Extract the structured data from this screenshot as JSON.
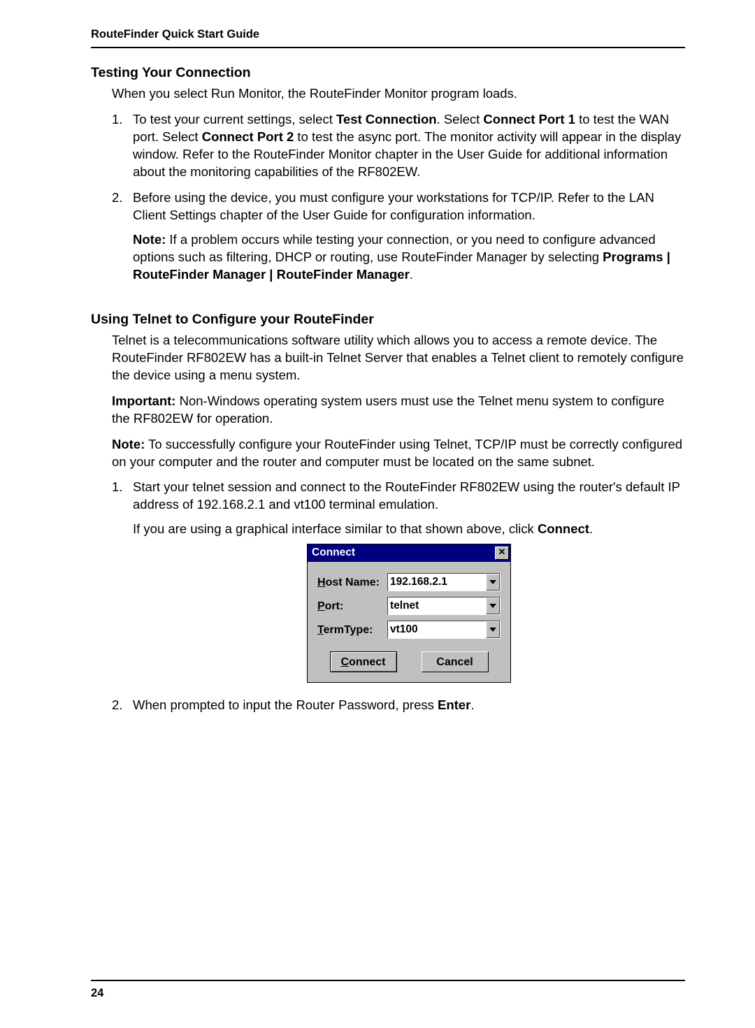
{
  "header": {
    "title": "RouteFinder Quick Start Guide"
  },
  "section1": {
    "heading": "Testing Your Connection",
    "intro": "When you select Run Monitor, the RouteFinder Monitor program loads.",
    "items": {
      "n1": "1.",
      "p1a": "To test your current settings, select ",
      "p1b": "Test Connection",
      "p1c": ".  Select ",
      "p1d": "Connect Port 1",
      "p1e": " to test the WAN port.  Select ",
      "p1f": "Connect Port 2",
      "p1g": " to test the async port.  The monitor activity will appear in the display window.  Refer to the RouteFinder Monitor chapter in the User Guide for additional information about the monitoring capabilities of the RF802EW.",
      "n2": "2.",
      "p2": "Before using the device, you must configure your workstations for TCP/IP.  Refer to the LAN Client Settings chapter of the User Guide for configuration information.",
      "p2note_a": "Note:",
      "p2note_b": " If a problem occurs while testing your connection, or you need to configure advanced options such as filtering, DHCP or routing, use RouteFinder Manager by selecting ",
      "p2note_c": "Programs | RouteFinder Manager | RouteFinder Manager",
      "p2note_d": "."
    }
  },
  "section2": {
    "heading": "Using Telnet to Configure your RouteFinder",
    "p1": "Telnet is a telecommunications software utility which allows you to access a remote device. The RouteFinder RF802EW has a built-in Telnet Server that enables a Telnet client to remotely configure the device using a menu system.",
    "p2a": "Important:",
    "p2b": " Non-Windows operating system users must use the Telnet menu system to configure the RF802EW for operation.",
    "p3a": "Note:",
    "p3b": " To successfully configure your RouteFinder using Telnet, TCP/IP must be correctly configured on your computer and the router and computer must be located on the same subnet.",
    "items": {
      "n1": "1.",
      "p1": "Start your telnet session and connect to the RouteFinder RF802EW using the router's default IP address of 192.168.2.1 and vt100 terminal emulation.",
      "p1b_a": "If you are using a graphical interface similar to that shown above, click ",
      "p1b_b": "Connect",
      "p1b_c": ".",
      "n2": "2.",
      "p2a": "When prompted to input the Router Password, press ",
      "p2b": "Enter",
      "p2c": "."
    }
  },
  "dialog": {
    "title": "Connect",
    "labels": {
      "host_u": "H",
      "host_rest": "ost Name:",
      "port_u": "P",
      "port_rest": "ort:",
      "term_u": "T",
      "term_rest": "ermType:"
    },
    "values": {
      "host": "192.168.2.1",
      "port": "telnet",
      "term": "vt100"
    },
    "buttons": {
      "connect_u": "C",
      "connect_rest": "onnect",
      "cancel": "Cancel"
    }
  },
  "footer": {
    "page": "24"
  }
}
